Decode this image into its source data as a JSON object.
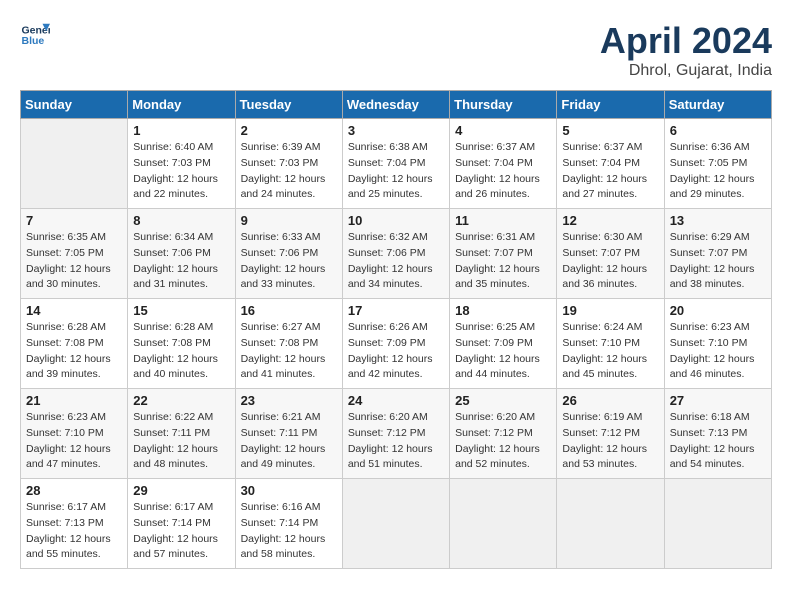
{
  "header": {
    "logo_line1": "General",
    "logo_line2": "Blue",
    "title": "April 2024",
    "subtitle": "Dhrol, Gujarat, India"
  },
  "calendar": {
    "days_of_week": [
      "Sunday",
      "Monday",
      "Tuesday",
      "Wednesday",
      "Thursday",
      "Friday",
      "Saturday"
    ],
    "weeks": [
      [
        {
          "day": "",
          "info": ""
        },
        {
          "day": "1",
          "info": "Sunrise: 6:40 AM\nSunset: 7:03 PM\nDaylight: 12 hours\nand 22 minutes."
        },
        {
          "day": "2",
          "info": "Sunrise: 6:39 AM\nSunset: 7:03 PM\nDaylight: 12 hours\nand 24 minutes."
        },
        {
          "day": "3",
          "info": "Sunrise: 6:38 AM\nSunset: 7:04 PM\nDaylight: 12 hours\nand 25 minutes."
        },
        {
          "day": "4",
          "info": "Sunrise: 6:37 AM\nSunset: 7:04 PM\nDaylight: 12 hours\nand 26 minutes."
        },
        {
          "day": "5",
          "info": "Sunrise: 6:37 AM\nSunset: 7:04 PM\nDaylight: 12 hours\nand 27 minutes."
        },
        {
          "day": "6",
          "info": "Sunrise: 6:36 AM\nSunset: 7:05 PM\nDaylight: 12 hours\nand 29 minutes."
        }
      ],
      [
        {
          "day": "7",
          "info": "Sunrise: 6:35 AM\nSunset: 7:05 PM\nDaylight: 12 hours\nand 30 minutes."
        },
        {
          "day": "8",
          "info": "Sunrise: 6:34 AM\nSunset: 7:06 PM\nDaylight: 12 hours\nand 31 minutes."
        },
        {
          "day": "9",
          "info": "Sunrise: 6:33 AM\nSunset: 7:06 PM\nDaylight: 12 hours\nand 33 minutes."
        },
        {
          "day": "10",
          "info": "Sunrise: 6:32 AM\nSunset: 7:06 PM\nDaylight: 12 hours\nand 34 minutes."
        },
        {
          "day": "11",
          "info": "Sunrise: 6:31 AM\nSunset: 7:07 PM\nDaylight: 12 hours\nand 35 minutes."
        },
        {
          "day": "12",
          "info": "Sunrise: 6:30 AM\nSunset: 7:07 PM\nDaylight: 12 hours\nand 36 minutes."
        },
        {
          "day": "13",
          "info": "Sunrise: 6:29 AM\nSunset: 7:07 PM\nDaylight: 12 hours\nand 38 minutes."
        }
      ],
      [
        {
          "day": "14",
          "info": "Sunrise: 6:28 AM\nSunset: 7:08 PM\nDaylight: 12 hours\nand 39 minutes."
        },
        {
          "day": "15",
          "info": "Sunrise: 6:28 AM\nSunset: 7:08 PM\nDaylight: 12 hours\nand 40 minutes."
        },
        {
          "day": "16",
          "info": "Sunrise: 6:27 AM\nSunset: 7:08 PM\nDaylight: 12 hours\nand 41 minutes."
        },
        {
          "day": "17",
          "info": "Sunrise: 6:26 AM\nSunset: 7:09 PM\nDaylight: 12 hours\nand 42 minutes."
        },
        {
          "day": "18",
          "info": "Sunrise: 6:25 AM\nSunset: 7:09 PM\nDaylight: 12 hours\nand 44 minutes."
        },
        {
          "day": "19",
          "info": "Sunrise: 6:24 AM\nSunset: 7:10 PM\nDaylight: 12 hours\nand 45 minutes."
        },
        {
          "day": "20",
          "info": "Sunrise: 6:23 AM\nSunset: 7:10 PM\nDaylight: 12 hours\nand 46 minutes."
        }
      ],
      [
        {
          "day": "21",
          "info": "Sunrise: 6:23 AM\nSunset: 7:10 PM\nDaylight: 12 hours\nand 47 minutes."
        },
        {
          "day": "22",
          "info": "Sunrise: 6:22 AM\nSunset: 7:11 PM\nDaylight: 12 hours\nand 48 minutes."
        },
        {
          "day": "23",
          "info": "Sunrise: 6:21 AM\nSunset: 7:11 PM\nDaylight: 12 hours\nand 49 minutes."
        },
        {
          "day": "24",
          "info": "Sunrise: 6:20 AM\nSunset: 7:12 PM\nDaylight: 12 hours\nand 51 minutes."
        },
        {
          "day": "25",
          "info": "Sunrise: 6:20 AM\nSunset: 7:12 PM\nDaylight: 12 hours\nand 52 minutes."
        },
        {
          "day": "26",
          "info": "Sunrise: 6:19 AM\nSunset: 7:12 PM\nDaylight: 12 hours\nand 53 minutes."
        },
        {
          "day": "27",
          "info": "Sunrise: 6:18 AM\nSunset: 7:13 PM\nDaylight: 12 hours\nand 54 minutes."
        }
      ],
      [
        {
          "day": "28",
          "info": "Sunrise: 6:17 AM\nSunset: 7:13 PM\nDaylight: 12 hours\nand 55 minutes."
        },
        {
          "day": "29",
          "info": "Sunrise: 6:17 AM\nSunset: 7:14 PM\nDaylight: 12 hours\nand 57 minutes."
        },
        {
          "day": "30",
          "info": "Sunrise: 6:16 AM\nSunset: 7:14 PM\nDaylight: 12 hours\nand 58 minutes."
        },
        {
          "day": "",
          "info": ""
        },
        {
          "day": "",
          "info": ""
        },
        {
          "day": "",
          "info": ""
        },
        {
          "day": "",
          "info": ""
        }
      ]
    ]
  }
}
